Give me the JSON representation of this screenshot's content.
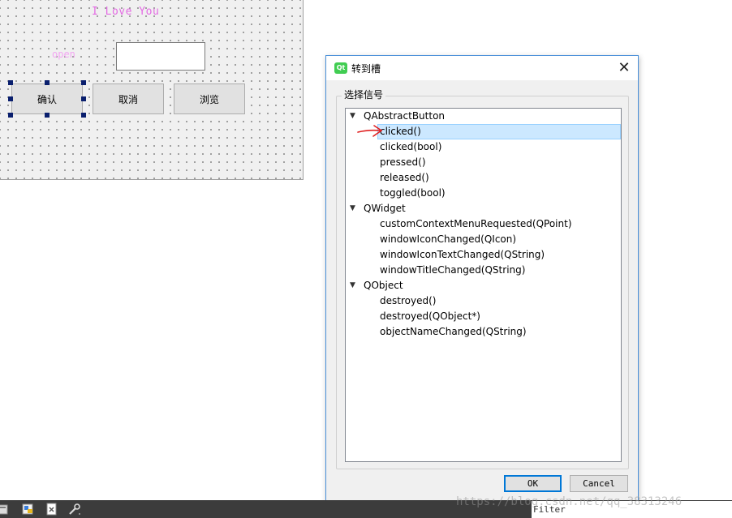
{
  "form": {
    "title": "I Love You",
    "open_label": "open",
    "buttons": [
      "确认",
      "取消",
      "浏览"
    ]
  },
  "dialog": {
    "title": "转到槽",
    "close_glyph": "✕",
    "app_icon_text": "Qt",
    "group_label": "选择信号",
    "tree": [
      {
        "type": "parent",
        "label": "QAbstractButton",
        "expanded": true
      },
      {
        "type": "child",
        "label": "clicked()",
        "selected": true
      },
      {
        "type": "child",
        "label": "clicked(bool)"
      },
      {
        "type": "child",
        "label": "pressed()"
      },
      {
        "type": "child",
        "label": "released()"
      },
      {
        "type": "child",
        "label": "toggled(bool)"
      },
      {
        "type": "parent",
        "label": "QWidget",
        "expanded": true
      },
      {
        "type": "child",
        "label": "customContextMenuRequested(QPoint)"
      },
      {
        "type": "child",
        "label": "windowIconChanged(QIcon)"
      },
      {
        "type": "child",
        "label": "windowIconTextChanged(QString)"
      },
      {
        "type": "child",
        "label": "windowTitleChanged(QString)"
      },
      {
        "type": "parent",
        "label": "QObject",
        "expanded": true
      },
      {
        "type": "child",
        "label": "destroyed()"
      },
      {
        "type": "child",
        "label": "destroyed(QObject*)"
      },
      {
        "type": "child",
        "label": "objectNameChanged(QString)"
      }
    ],
    "ok_label": "OK",
    "cancel_label": "Cancel"
  },
  "bottom": {
    "filter_label": "Filter",
    "watermark": "https://blog.csdn.net/qq_38313246",
    "icons": [
      "tool-icon-1",
      "tool-icon-2",
      "close-file-icon",
      "wrench-icon"
    ]
  },
  "colors": {
    "selection": "#cce8ff",
    "accent": "#0078d7",
    "form_title": "#e46ae4",
    "annotation_arrow": "#e02020"
  }
}
